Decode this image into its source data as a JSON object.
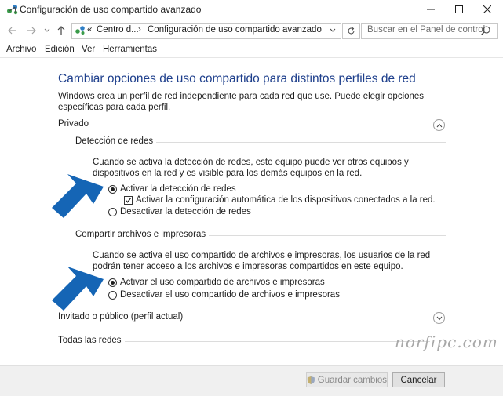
{
  "window": {
    "title": "Configuración de uso compartido avanzado"
  },
  "address": {
    "separator": "«",
    "crumb_root": "Centro d...",
    "crumb_arrow": "›",
    "crumb_current": "Configuración de uso compartido avanzado",
    "search_placeholder": "Buscar en el Panel de control"
  },
  "menu": [
    "Archivo",
    "Edición",
    "Ver",
    "Herramientas"
  ],
  "content": {
    "heading": "Cambiar opciones de uso compartido para distintos perfiles de red",
    "intro": "Windows crea un perfil de red independiente para cada red que use. Puede elegir opciones específicas para cada perfil.",
    "private": {
      "label": "Privado",
      "network_discovery": {
        "label": "Detección de redes",
        "description": "Cuando se activa la detección de redes, este equipo puede ver otros equipos y dispositivos en la red y es visible para los demás equipos en la red.",
        "option_on": "Activar la detección de redes",
        "auto_config": "Activar la configuración automática de los dispositivos conectados a la red.",
        "option_off": "Desactivar la detección de redes"
      },
      "file_sharing": {
        "label": "Compartir archivos e impresoras",
        "description": "Cuando se activa el uso compartido de archivos e impresoras, los usuarios de la red podrán tener acceso a los archivos e impresoras compartidos en este equipo.",
        "option_on": "Activar el uso compartido de archivos e impresoras",
        "option_off": "Desactivar el uso compartido de archivos e impresoras"
      }
    },
    "guest": {
      "label": "Invitado o público (perfil actual)"
    },
    "all": {
      "label": "Todas las redes"
    }
  },
  "watermark": "norfipc.com",
  "footer": {
    "save": "Guardar cambios",
    "cancel": "Cancelar"
  },
  "colors": {
    "accent": "#1e3f8c",
    "arrow": "#1565b5"
  }
}
